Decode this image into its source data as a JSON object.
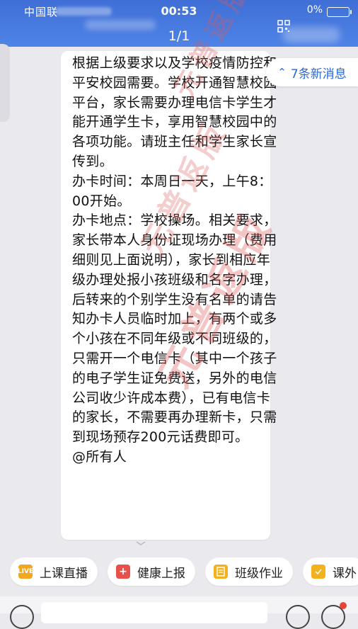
{
  "status_bar": {
    "carrier": "中国联",
    "time": "00:53",
    "battery": "0%"
  },
  "header": {
    "title": "1/1"
  },
  "new_messages": {
    "label": "7条新消息"
  },
  "message": {
    "text": "根据上级要求以及学校疫情防控和平安校园需要。学校开通智慧校园平台，家长需要办理电信卡学生才能开通学生卡，享用智慧校园中的各项功能。请班主任和学生家长宣传到。\n办卡时间：本周日一天，上午8：00开始。\n办卡地点：学校操场。相关要求，家长带本人身份证现场办理（费用细则见上面说明），家长到相应年级办理处报小孩班级和名字办理，后转来的个别学生没有名单的请告知办卡人员临时加上，有两个或多个小孩在不同年级或不同班级的，只需开一个电信卡（其中一个孩子的电子学生证免费送，另外的电信公司收少许成本费），已有电信卡的家长，不需要再办理新卡，只需到现场预存200元话费即可。\n@所有人"
  },
  "watermark": {
    "text": "元普返版"
  },
  "shortcuts": [
    {
      "label": "上课直播",
      "icon": "live-icon",
      "icon_text": "LIVE"
    },
    {
      "label": "健康上报",
      "icon": "health-report-icon",
      "icon_text": "+"
    },
    {
      "label": "班级作业",
      "icon": "homework-icon",
      "icon_text": ""
    },
    {
      "label": "课外",
      "icon": "extracurricular-icon",
      "icon_text": ""
    }
  ],
  "colors": {
    "header_blue": "#4a7ee3",
    "link_blue": "#2a68d8",
    "watermark_red": "#dc5a5a"
  }
}
